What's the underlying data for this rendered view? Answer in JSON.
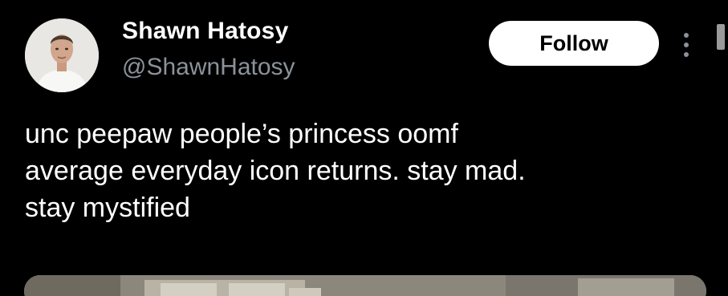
{
  "author": {
    "display_name": "Shawn Hatosy",
    "handle": "@ShawnHatosy",
    "avatar_icon": "profile-photo"
  },
  "actions": {
    "follow_label": "Follow",
    "more_icon": "more-vertical-icon"
  },
  "tweet": {
    "text": "unc peepaw people’s princess oomf\naverage everyday icon returns. stay mad.\nstay mystified"
  },
  "colors": {
    "background": "#000000",
    "text": "#ffffff",
    "secondary_text": "#8b9299",
    "button_bg": "#ffffff",
    "button_text": "#000000"
  }
}
